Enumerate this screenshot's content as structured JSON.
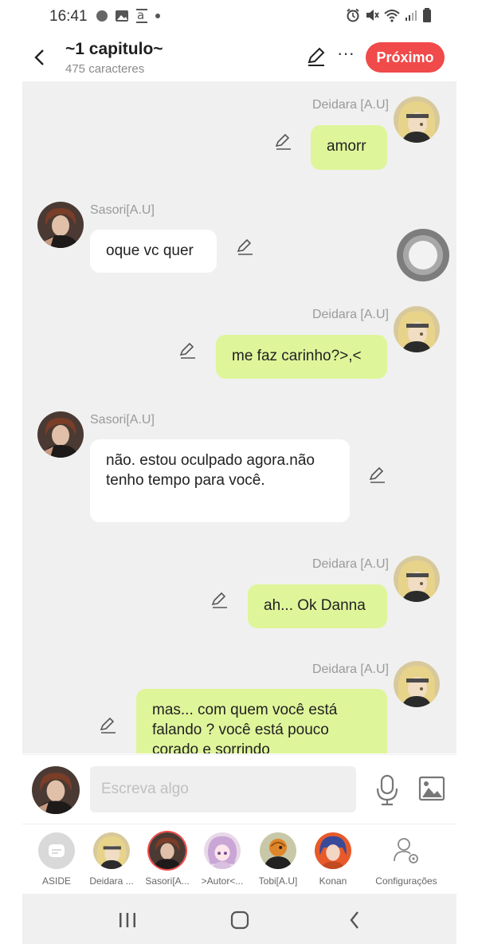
{
  "status_bar": {
    "time": "16:41"
  },
  "header": {
    "title": "~1 capitulo~",
    "char_count": "475 caracteres",
    "next_label": "Próximo",
    "more_label": "···"
  },
  "messages": [
    {
      "sender": "Deidara [A.U]",
      "side": "right",
      "text": "amorr"
    },
    {
      "sender": "Sasori[A.U]",
      "side": "left",
      "text": "oque vc quer"
    },
    {
      "sender": "Deidara [A.U]",
      "side": "right",
      "text": "me faz carinho?>,<"
    },
    {
      "sender": "Sasori[A.U]",
      "side": "left",
      "text": "não. estou oculpado agora.não tenho tempo para você."
    },
    {
      "sender": "Deidara [A.U]",
      "side": "right",
      "text": "ah... Ok Danna"
    },
    {
      "sender": "Deidara [A.U]",
      "side": "right",
      "text": "mas... com quem você  está falando ? você  está  pouco corado e sorrindo"
    }
  ],
  "input": {
    "placeholder": "Escreva algo"
  },
  "characters": [
    {
      "label": "ASIDE"
    },
    {
      "label": "Deidara ..."
    },
    {
      "label": "Sasori[A..."
    },
    {
      "label": ">Autor<..."
    },
    {
      "label": "Tobi[A.U]"
    },
    {
      "label": "Konan"
    },
    {
      "label": "Configurações"
    }
  ],
  "colors": {
    "accent": "#f04a4a",
    "bubble_right": "#dff59a",
    "bubble_left": "#ffffff",
    "chat_bg": "#f0f0f0"
  }
}
